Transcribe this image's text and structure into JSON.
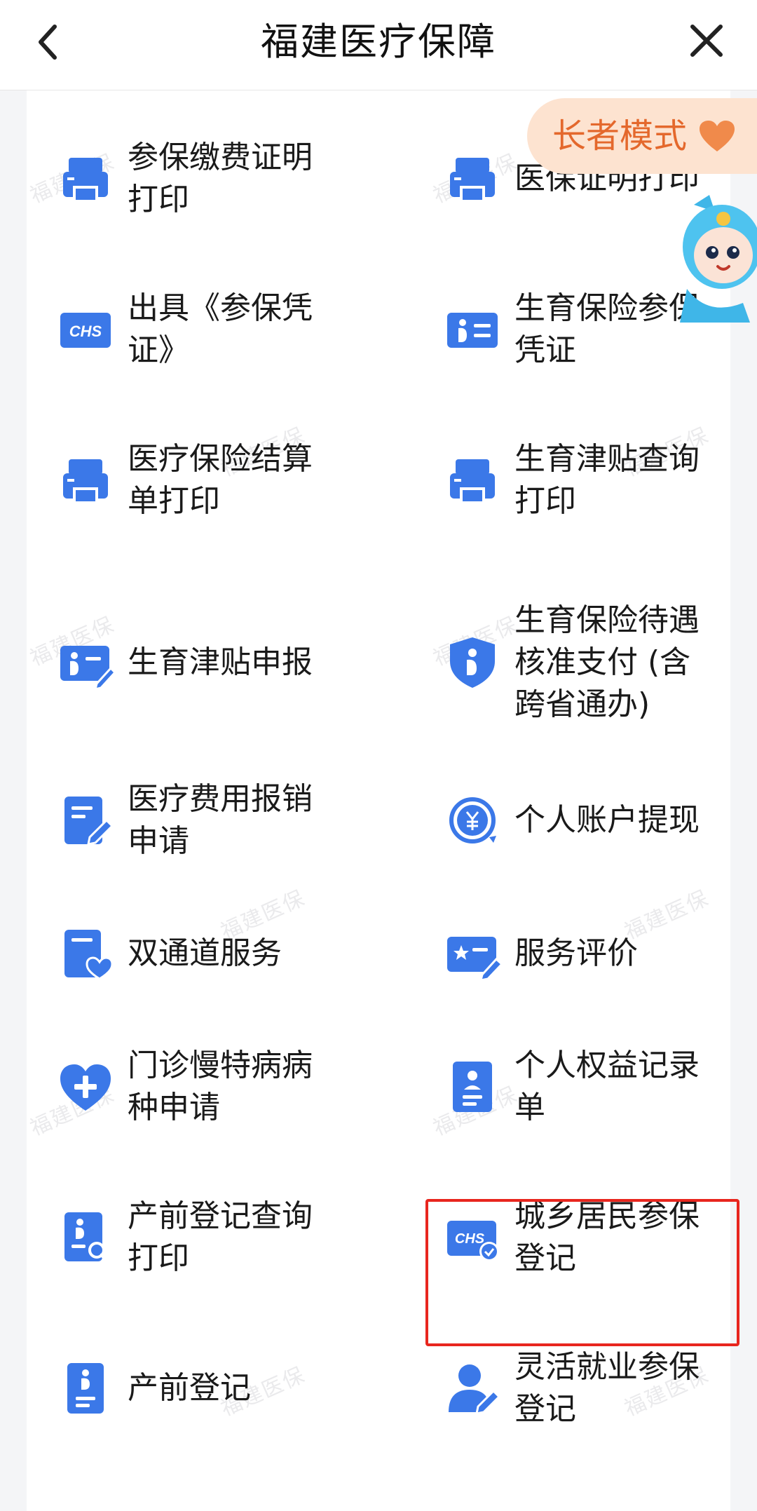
{
  "header": {
    "title": "福建医疗保障",
    "back_icon": "chevron-left-icon",
    "close_icon": "close-icon"
  },
  "elder_mode": {
    "label": "长者模式",
    "icon": "heart-icon"
  },
  "partial_top": [
    "打印",
    "打印"
  ],
  "services": [
    {
      "label": "参保缴费证明打印",
      "icon": "printer-icon"
    },
    {
      "label": "医保证明打印",
      "icon": "printer-icon"
    },
    {
      "label": "出具《参保凭证》",
      "icon": "chs-card-icon"
    },
    {
      "label": "生育保险参保凭证",
      "icon": "pregnancy-card-icon"
    },
    {
      "label": "医疗保险结算单打印",
      "icon": "printer-icon"
    },
    {
      "label": "生育津贴查询打印",
      "icon": "printer-icon"
    },
    {
      "label": "生育津贴申报",
      "icon": "pregnancy-edit-card-icon"
    },
    {
      "label": "生育保险待遇核准支付 (含跨省通办)",
      "icon": "pregnancy-shield-icon"
    },
    {
      "label": "医疗费用报销申请",
      "icon": "document-edit-icon"
    },
    {
      "label": "个人账户提现",
      "icon": "yuan-refresh-icon"
    },
    {
      "label": "双通道服务",
      "icon": "document-heart-icon"
    },
    {
      "label": "服务评价",
      "icon": "star-edit-card-icon"
    },
    {
      "label": "门诊慢特病病种申请",
      "icon": "heart-plus-icon"
    },
    {
      "label": "个人权益记录单",
      "icon": "person-document-icon"
    },
    {
      "label": "产前登记查询打印",
      "icon": "pregnancy-search-icon"
    },
    {
      "label": "城乡居民参保登记",
      "icon": "chs-check-card-icon"
    },
    {
      "label": "产前登记",
      "icon": "pregnancy-document-icon"
    },
    {
      "label": "灵活就业参保登记",
      "icon": "person-edit-icon"
    }
  ],
  "watermark": "福建医保",
  "colors": {
    "icon_blue": "#3b78e8",
    "highlight": "#e8261e",
    "elder_text": "#e4682c",
    "elder_bg": "#fde3d0"
  }
}
